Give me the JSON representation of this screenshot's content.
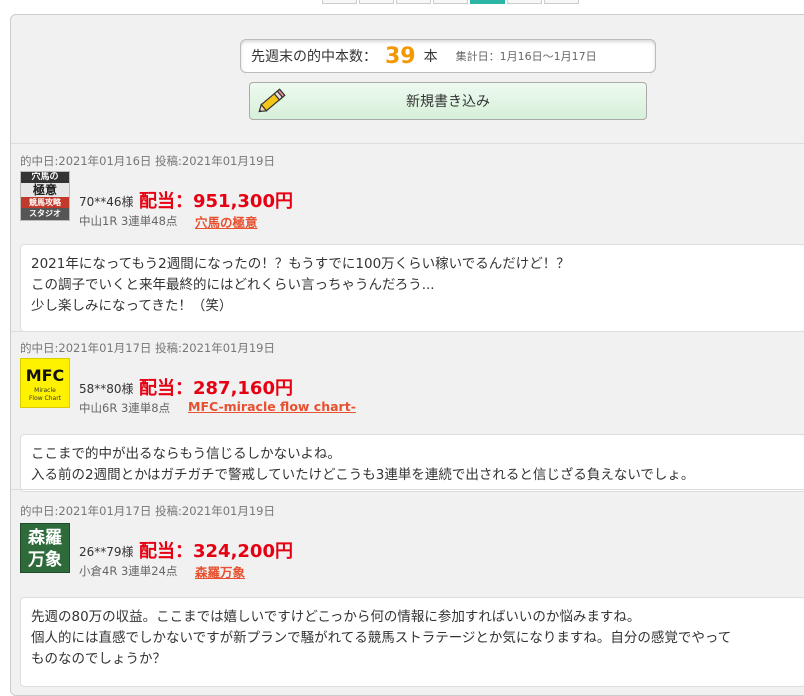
{
  "summary": {
    "label": "先週末の的中本数：",
    "count": "39",
    "unit": "本",
    "period": "集計日：1月16日～1月17日"
  },
  "new_post": {
    "label": "新規書き込み"
  },
  "entries": [
    {
      "meta": "的中日:2021年01月16日 投稿:2021年01月19日",
      "thumb_lines": [
        "穴馬の",
        "極意",
        "競馬攻略",
        "スタジオ"
      ],
      "user": "70**46様",
      "payout": "配当：951,300円",
      "race": "中山1R 3連単48点",
      "product": "穴馬の極意",
      "comment": [
        "2021年になってもう2週間になったの！？もうすでに100万くらい稼いでるんだけど！？",
        "この調子でいくと来年最終的にはどれくらい言っちゃうんだろう...",
        "少し楽しみになってきた！（笑）"
      ]
    },
    {
      "meta": "的中日:2021年01月17日 投稿:2021年01月19日",
      "thumb_lines": [
        "MFC",
        "Miracle",
        "Flow Chart"
      ],
      "user": "58**80様",
      "payout": "配当：287,160円",
      "race": "中山6R 3連単8点",
      "product": "MFC-miracle flow chart-",
      "comment": [
        "ここまで的中が出るならもう信じるしかないよね。",
        "入る前の2週間とかはガチガチで警戒していたけどこうも3連単を連続で出されると信じざる負えないでしょ。"
      ]
    },
    {
      "meta": "的中日:2021年01月17日 投稿:2021年01月19日",
      "thumb_lines": [
        "森羅",
        "万象"
      ],
      "user": "26**79様",
      "payout": "配当：324,200円",
      "race": "小倉4R 3連単24点",
      "product": "森羅万象",
      "comment": [
        "先週の80万の収益。ここまでは嬉しいですけどこっから何の情報に参加すればいいのか悩みますね。",
        "個人的には直感でしかないですが新プランで騒がれてる競馬ストラテージとか気になりますね。自分の感覚でやって",
        "ものなのでしょうか？"
      ]
    }
  ]
}
